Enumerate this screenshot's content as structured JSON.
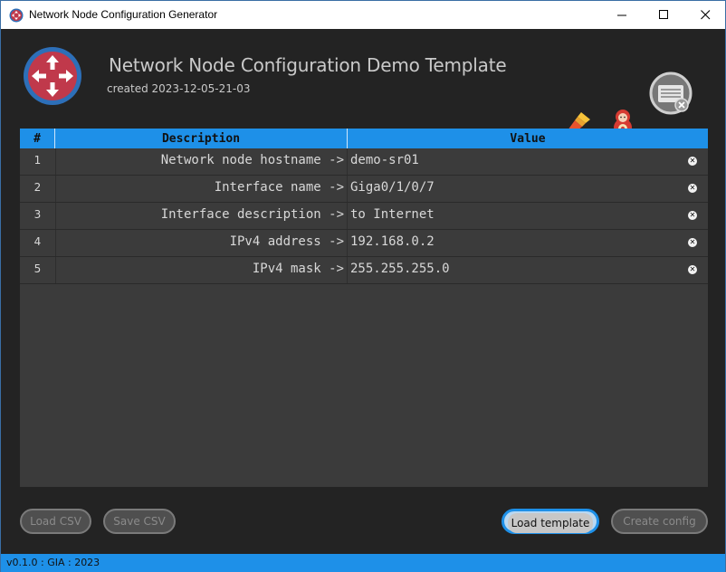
{
  "window": {
    "title": "Network Node Configuration Generator",
    "controls": {
      "minimize": "—",
      "maximize": "☐",
      "close": "✕"
    }
  },
  "header": {
    "title": "Network Node Configuration Demo Template",
    "created": "created 2023-12-05-21-03"
  },
  "icons": {
    "logo": "router-arrows-icon",
    "badge": "template-config-icon",
    "brush": "brush-icon",
    "doll": "matryoshka-icon"
  },
  "table": {
    "columns": {
      "num": "#",
      "description": "Description",
      "value": "Value"
    },
    "rows": [
      {
        "num": "1",
        "description": "Network node hostname ->",
        "value": "demo-sr01"
      },
      {
        "num": "2",
        "description": "Interface name ->",
        "value": "Giga0/1/0/7"
      },
      {
        "num": "3",
        "description": "Interface description ->",
        "value": "to Internet"
      },
      {
        "num": "4",
        "description": "IPv4 address ->",
        "value": "192.168.0.2"
      },
      {
        "num": "5",
        "description": "IPv4 mask ->",
        "value": "255.255.255.0"
      }
    ]
  },
  "buttons": {
    "load_csv": "Load CSV",
    "save_csv": "Save CSV",
    "load_template": "Load template",
    "create_config": "Create config"
  },
  "status": {
    "text": "v0.1.0 : GIA : 2023"
  },
  "colors": {
    "accent": "#1e90e8",
    "background": "#232323",
    "table_bg": "#3b3b3b",
    "logo_red": "#c0394b",
    "logo_blue": "#2d6fb8"
  }
}
